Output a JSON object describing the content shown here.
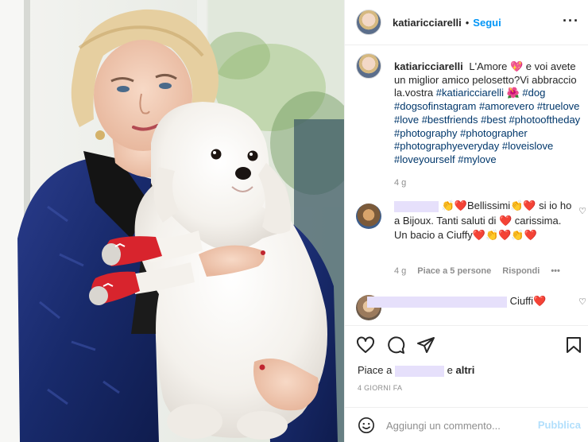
{
  "post": {
    "username": "katiaricciarelli",
    "follow_label": "Segui",
    "more_icon": "more-horizontal-icon"
  },
  "caption": {
    "username": "katiaricciarelli",
    "text": "L'Amore 💖 e voi avete un miglior amico pelosetto?Vi abbraccio la.vostra",
    "tags": "#katiaricciarelli 🌺 #dog #dogsofinstagram #amorevero #truelove #love #bestfriends #best #photooftheday #photography #photographer #photographyeveryday #loveislove #loveyourself #mylove",
    "time": "4 g"
  },
  "comments": [
    {
      "text": "👏❤️Bellissimi👏❤️ si io ho a Bijoux. Tanti saluti di ❤️ carissima. Un bacio a Ciuffy❤️👏❤️👏❤️",
      "time": "4 g",
      "likes_label": "Piace a 5 persone",
      "reply_label": "Rispondi",
      "more_label": "•••"
    },
    {
      "text": "Ciuffi❤️"
    }
  ],
  "likes": {
    "prefix": "Piace a",
    "joiner": "e",
    "others": "altri"
  },
  "timestamp": "4 GIORNI FA",
  "add_comment": {
    "placeholder": "Aggiungi un commento...",
    "publish_label": "Pubblica"
  },
  "colors": {
    "link": "#0095f6",
    "hashtag": "#00376b",
    "muted": "#8e8e8e"
  }
}
